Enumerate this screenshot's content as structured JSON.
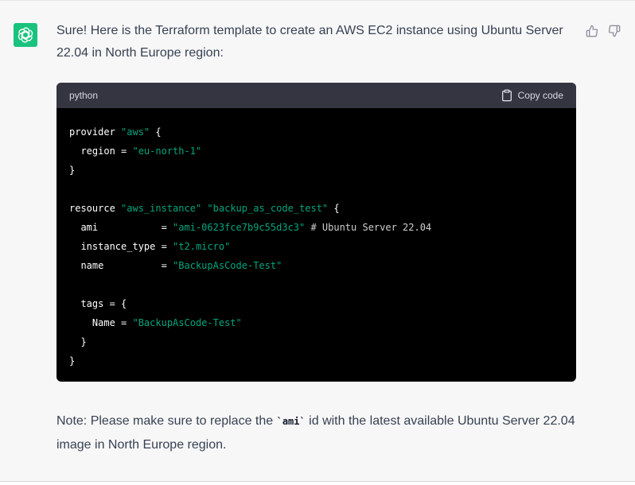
{
  "message": {
    "intro_text": "Sure! Here is the Terraform template to create an AWS EC2 instance using Ubuntu Server 22.04 in North Europe region:"
  },
  "code_block": {
    "language": "python",
    "copy_label": "Copy code",
    "lines": {
      "l1": {
        "a": "provider ",
        "b": "\"aws\"",
        "c": " {"
      },
      "l2": {
        "a": "  region = ",
        "b": "\"eu-north-1\""
      },
      "l3": {
        "a": "}"
      },
      "l5": {
        "a": "resource ",
        "b": "\"aws_instance\"",
        "c": " ",
        "d": "\"backup_as_code_test\"",
        "e": " {"
      },
      "l6": {
        "a": "  ami           = ",
        "b": "\"ami-0623fce7b9c55d3c3\"",
        "c": " # Ubuntu Server 22.04"
      },
      "l7": {
        "a": "  instance_type = ",
        "b": "\"t2.micro\""
      },
      "l8": {
        "a": "  name          = ",
        "b": "\"BackupAsCode-Test\""
      },
      "l10": {
        "a": "  tags = {"
      },
      "l11": {
        "a": "    Name = ",
        "b": "\"BackupAsCode-Test\""
      },
      "l12": {
        "a": "  }"
      },
      "l13": {
        "a": "}"
      }
    }
  },
  "note": {
    "before": "Note: Please make sure to replace the ",
    "code": "`ami`",
    "after": " id with the latest available Ubuntu Server 22.04 image in North Europe region."
  },
  "icons": {
    "avatar": "openai-logo-icon",
    "thumbs_up": "thumbs-up-icon",
    "thumbs_down": "thumbs-down-icon",
    "copy": "clipboard-icon"
  },
  "colors": {
    "avatar_bg": "#19c37d",
    "code_bg": "#000000",
    "code_header_bg": "#343541",
    "string": "#00a67d"
  }
}
